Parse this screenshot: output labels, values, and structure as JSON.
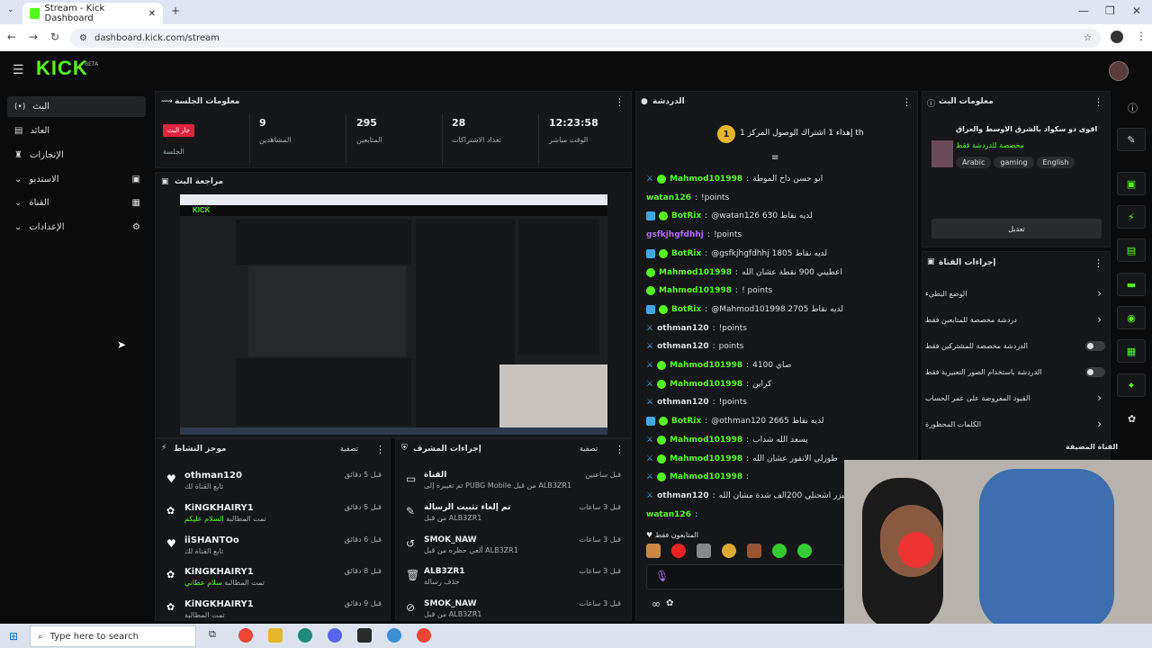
{
  "browser": {
    "tab_title": "Stream - Kick Dashboard",
    "url": "dashboard.kick.com/stream"
  },
  "header": {
    "logo": "KICK",
    "beta": "BETA"
  },
  "sidebar": {
    "items": [
      {
        "label": "البث",
        "icon": "broadcast-icon",
        "active": true
      },
      {
        "label": "العائد",
        "icon": "revenue-icon",
        "active": false
      },
      {
        "label": "الإنجازات",
        "icon": "trophy-icon",
        "active": false
      },
      {
        "label": "الاستديو",
        "icon": "studio-icon",
        "active": false
      },
      {
        "label": "القناة",
        "icon": "channel-icon",
        "active": false
      },
      {
        "label": "الإعدادات",
        "icon": "gear-icon",
        "active": false
      }
    ]
  },
  "session": {
    "title": "معلومات الجلسة",
    "live_badge": "جار البث",
    "session_label": "الجلسة",
    "stats": [
      {
        "value": "9",
        "label": "المشاهدين"
      },
      {
        "value": "295",
        "label": "المتابعين"
      },
      {
        "value": "28",
        "label": "تعداد الاشتراكات"
      },
      {
        "value": "12:23:58",
        "label": "الوقت مباشر"
      }
    ]
  },
  "preview": {
    "title": "مراجعة البث"
  },
  "activity": {
    "title": "موجز النشاط",
    "filter": "تصفية",
    "items": [
      {
        "name": "othman120",
        "sub": "تابع القناة لك",
        "time": "قبل 5 دقائق",
        "highlight": ""
      },
      {
        "name": "KiNGKHAIRY1",
        "sub": "تمت المطالبة",
        "highlight": "السلام عليكم",
        "time": "قبل 5 دقائق"
      },
      {
        "name": "iiSHANTOo",
        "sub": "تابع القناة لك",
        "time": "قبل 6 دقائق",
        "highlight": ""
      },
      {
        "name": "KiNGKHAIRY1",
        "sub": "تمت المطالبة",
        "highlight": "سلام عطاني",
        "time": "قبل 8 دقائق"
      },
      {
        "name": "KiNGKHAIRY1",
        "sub": "تمت المطالبة",
        "time": "قبل 9 دقائق",
        "highlight": ""
      }
    ]
  },
  "mod_actions": {
    "title": "إجراءات المشرف",
    "filter": "تصفية",
    "items": [
      {
        "name": "القناة",
        "sub": "تم تغييره إلى PUBG Mobile من قبل ALB3ZR1",
        "time": "قبل ساعتين"
      },
      {
        "name": "تم إلغاء تثبيت الرسالة",
        "sub": "من قبل ALB3ZR1",
        "time": "قبل 3 ساعات"
      },
      {
        "name": "SMOK_NAW",
        "sub": "ألغي حظره من قبل ALB3ZR1",
        "time": "قبل 3 ساعات"
      },
      {
        "name": "ALB3ZR1",
        "sub": "حذف رسالة",
        "time": "قبل 3 ساعات"
      },
      {
        "name": "SMOK_NAW",
        "sub": "من قبل ALB3ZR1",
        "time": "قبل 3 ساعات"
      }
    ]
  },
  "chat": {
    "title": "الدردشة",
    "pinned": "إهداء 1 اشتراك الوصول المركز 1 th",
    "followers_only": "المتابعون فقط",
    "messages": [
      {
        "user": "Mahmod101998",
        "text": "ابو حسن داخ الموطة",
        "badges": [
          "mod",
          "sub"
        ],
        "color": "#53fc18"
      },
      {
        "user": "watan126",
        "text": "!points",
        "badges": [],
        "color": "#53fc18"
      },
      {
        "user": "BotRix",
        "text": "@watan126 630 لديه نقاط",
        "badges": [
          "bot",
          "sub"
        ],
        "color": "#53fc18"
      },
      {
        "user": "gsfkjhgfdhhj",
        "text": "!points",
        "badges": [],
        "color": "#b36bff"
      },
      {
        "user": "BotRix",
        "text": "@gsfkjhgfdhhj 1805 لديه نقاط",
        "badges": [
          "bot",
          "sub"
        ],
        "color": "#53fc18"
      },
      {
        "user": "Mahmod101998",
        "text": "اعطيني 900 نقطة عشان الله",
        "badges": [
          "sub"
        ],
        "color": "#53fc18"
      },
      {
        "user": "Mahmod101998",
        "text": "! points",
        "badges": [
          "sub"
        ],
        "color": "#53fc18"
      },
      {
        "user": "BotRix",
        "text": "@Mahmod101998 2705 لديه نقاط",
        "badges": [
          "bot",
          "sub"
        ],
        "color": "#53fc18"
      },
      {
        "user": "othman120",
        "text": "!points",
        "badges": [
          "mod"
        ],
        "color": "#dddddd"
      },
      {
        "user": "othman120",
        "text": "points",
        "badges": [
          "mod"
        ],
        "color": "#dddddd"
      },
      {
        "user": "Mahmod101998",
        "text": "4100 صاي",
        "badges": [
          "mod",
          "sub"
        ],
        "color": "#53fc18"
      },
      {
        "user": "Mahmod101998",
        "text": "كراين",
        "badges": [
          "mod",
          "sub"
        ],
        "color": "#53fc18"
      },
      {
        "user": "othman120",
        "text": "!points",
        "badges": [
          "mod"
        ],
        "color": "#dddddd"
      },
      {
        "user": "BotRix",
        "text": "@othman120 2665 لديه نقاط",
        "badges": [
          "bot",
          "sub"
        ],
        "color": "#53fc18"
      },
      {
        "user": "Mahmod101998",
        "text": "يسعد الله شداب",
        "badges": [
          "mod",
          "sub"
        ],
        "color": "#53fc18"
      },
      {
        "user": "Mahmod101998",
        "text": "طورلي الانفور عشان الله",
        "badges": [
          "mod",
          "sub"
        ],
        "color": "#53fc18"
      },
      {
        "user": "Mahmod101998",
        "text": "",
        "badges": [
          "mod",
          "sub"
        ],
        "color": "#53fc18"
      },
      {
        "user": "othman120",
        "text": "بيزر اشحنلي 200الف شدة مشان الله",
        "badges": [
          "mod"
        ],
        "color": "#dddddd"
      },
      {
        "user": "watan126",
        "text": "",
        "badges": [],
        "color": "#53fc18"
      }
    ]
  },
  "stream_info": {
    "title": "معلومات البث",
    "stream_title": "اقوى دو سكواد بالشرق الاوسط والعراق",
    "chat_mode": "مخصصة للدردشة فقط",
    "tags": [
      "Arabic",
      "gaming",
      "English"
    ],
    "edit": "تعديل"
  },
  "channel_actions": {
    "title": "إجراءات القناة",
    "rows": [
      {
        "label": "الوضع البطيء",
        "type": "arrow"
      },
      {
        "label": "دردشة مخصصة للمتابعين فقط",
        "type": "arrow"
      },
      {
        "label": "الدردشة مخصصة للمشتركين فقط",
        "type": "toggle"
      },
      {
        "label": "الدردشة باستخدام الصور التعبيرية فقط",
        "type": "toggle"
      },
      {
        "label": "القيود المفروضة على عمر الحساب",
        "type": "arrow"
      },
      {
        "label": "الكلمات المحظورة",
        "type": "arrow"
      }
    ],
    "hosted": "القناة المضيفة"
  },
  "taskbar": {
    "search": "Type here to search"
  },
  "colors": {
    "accent": "#53fc18",
    "bg": "#0b0b0c",
    "panel": "#151618",
    "live": "#e0243d"
  }
}
